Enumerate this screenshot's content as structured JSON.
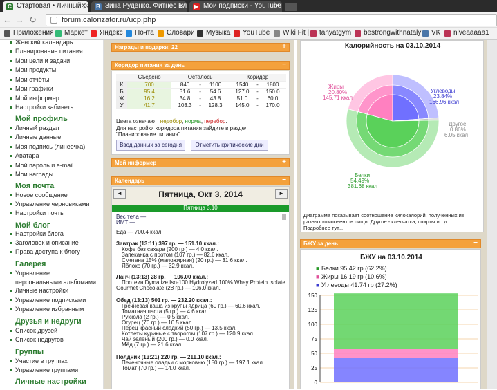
{
  "tabs": [
    {
      "label": "Стартовая • Личный разд"
    },
    {
      "label": "Зина Руденко. Фитнес Бл"
    },
    {
      "label": "Мои подписки - YouTube"
    }
  ],
  "url": "forum.calorizator.ru/ucp.php",
  "bookmarks": [
    "Приложения",
    "Маркет",
    "Яндекс",
    "Почта",
    "Словари",
    "Музыка",
    "YouTube",
    "Wiki Fit |",
    "tanyatgym",
    "bestrongwithnataly",
    "VK",
    "niveaaaaa1"
  ],
  "sidebar": {
    "links1": [
      "Женский календарь",
      "Планирование питания",
      "Мои цели и задачи",
      "Мои продукты",
      "Мои отчёты",
      "Мои графики",
      "Мой информер",
      "Настройки кабинета"
    ],
    "h_profile": "Мой профиль",
    "links2": [
      "Личный раздел",
      "Личные данные",
      "Моя подпись (линеечка)",
      "Аватара",
      "Мой пароль и e-mail",
      "Мои награды"
    ],
    "h_mail": "Моя почта",
    "links3": [
      "Новое сообщение",
      "Управление черновиками",
      "Настройки почты"
    ],
    "h_blog": "Мой блог",
    "links4": [
      "Настройки блога",
      "Заголовок и описание",
      "Права доступа к блогу"
    ],
    "h_gallery": "Галерея",
    "links5": [
      "Управление персональными альбомами",
      "Личные настройки",
      "Управление подписками",
      "Управление избранным"
    ],
    "h_friends": "Друзья и недруги",
    "links6": [
      "Список друзей",
      "Список недругов"
    ],
    "h_groups": "Группы",
    "links7": [
      "Участие в группах",
      "Управление группами"
    ],
    "h_settings": "Личные настройки"
  },
  "mid": {
    "awards": "Награды и подарки: 22",
    "corridor_title": "Коридор питания за день",
    "col_eaten": "Съедено",
    "col_left": "Осталось",
    "col_corr": "Коридор",
    "rows": [
      {
        "k": "К",
        "eaten": "700",
        "l1": "840",
        "l2": "1100",
        "c1": "1540",
        "c2": "1800"
      },
      {
        "k": "Б",
        "eaten": "95.4",
        "l1": "31.6",
        "l2": "54.6",
        "c1": "127.0",
        "c2": "150.0"
      },
      {
        "k": "Ж",
        "eaten": "16.2",
        "l1": "34.8",
        "l2": "43.8",
        "c1": "51.0",
        "c2": "60.0"
      },
      {
        "k": "У",
        "eaten": "41.7",
        "l1": "103.3",
        "l2": "128.3",
        "c1": "145.0",
        "c2": "170.0"
      }
    ],
    "colors_note": "Цвета означают:",
    "c_under": "недобор",
    "c_norm": "норма",
    "c_over": "перебор",
    "setup_note1": "Для настройки коридора питания зайдите в раздел",
    "setup_note2": "\"Планирование питания\".",
    "btn_enter": "Ввод данных за сегодня",
    "btn_crit": "Отметить критические дни",
    "informer": "Мой информер",
    "calendar": "Календарь",
    "date": "Пятница, Окт 3, 2014",
    "week": "Пятница 3.10",
    "weight": "Вес тела —",
    "bmi": "ИМТ —",
    "food_total": "Еда — 700.4 ккал.",
    "meals": [
      {
        "title": "Завтрак (13:11) 397 гр. — 151.10 ккал.:",
        "items": [
          "Кофе без сахара (200 гр.) — 4.0 ккал.",
          "Запеканка с протом (107 гр.) — 82.6 ккал.",
          "Сметана 15% (маложирная) (20 гр.) — 31.6 ккал.",
          "Яблоко (70 гр.) — 32.9 ккал."
        ]
      },
      {
        "title": "Ланч (13:13) 28 гр. — 106.00 ккал.:",
        "items": [
          "Протеин Dymatize Iso-100 Hydrolyzed 100% Whey Protein Isolate",
          "Gourmet Chocolate (28 гр.) — 106.0 ккал."
        ]
      },
      {
        "title": "Обед (13:13) 501 гр. — 232.20 ккал.:",
        "items": [
          "Гречневая каша из крупы ядрица (60 гр.) — 60.6 ккал.",
          "Томатная паста (5 гр.) — 4.6 ккал.",
          "Руккола (2 гр.) — 0.5 ккал.",
          "Огурец (70 гр.) — 10.5 ккал.",
          "Перец красный сладкий (50 гр.) — 13.5 ккал.",
          "Котлеты куриные с творогом (107 гр.) — 120.9 ккал.",
          "Чай зелёный (200 гр.) — 0.0 ккал.",
          "Мёд (7 гр.) — 21.6 ккал."
        ]
      },
      {
        "title": "Полдник (13:21) 220 гр. — 211.10 ккал.:",
        "items": [
          "Печеночные оладьи с морковью (150 гр.) — 197.1 ккал.",
          "Томат (70 гр.) — 14.0 ккал."
        ]
      }
    ]
  },
  "right": {
    "pie_title": "Калорийность на 03.10.2014",
    "fat": {
      "name": "Жиры",
      "pct": "20.80%",
      "kcal": "145.71 ккал"
    },
    "carb": {
      "name": "Углеводы",
      "pct": "23.84%",
      "kcal": "166.96 ккал"
    },
    "other": {
      "name": "Другое",
      "pct": "0.86%",
      "kcal": "6.05 ккал"
    },
    "prot": {
      "name": "Белки",
      "pct": "54.49%",
      "kcal": "381.68 ккал"
    },
    "pie_note1": "Диаграмма показывает соотношение килокалорий, полученных из",
    "pie_note2": "разных компонентов пищи. Другое - клетчатка, спирты и т.д.",
    "pie_note3": "Подробнее тут...",
    "bju_bar": "БЖУ за день",
    "bju_title": "БЖУ на 03.10.2014",
    "leg_prot": "Белки 95.42 гр (62.2%)",
    "leg_fat": "Жиры 16.19 гр (10.6%)",
    "leg_carb": "Углеводы 41.74 гр (27.2%)",
    "yticks": [
      "150",
      "125",
      "100",
      "75",
      "50",
      "25",
      "0"
    ]
  },
  "colors": {
    "protein": "#5ad15a",
    "fat": "#ff80c0",
    "carb": "#7070ff",
    "other": "#bbbbbb",
    "orange": "#f4a13c",
    "green": "#2e7d32"
  },
  "chart_data": [
    {
      "type": "pie",
      "title": "Калорийность на 03.10.2014",
      "labels": [
        "Белки",
        "Жиры",
        "Углеводы",
        "Другое"
      ],
      "values": [
        54.49,
        20.8,
        23.84,
        0.86
      ],
      "kcal": [
        381.68,
        145.71,
        166.96,
        6.05
      ]
    },
    {
      "type": "bar",
      "title": "БЖУ на 03.10.2014",
      "categories": [
        ""
      ],
      "series": [
        {
          "name": "Белки",
          "values": [
            95.42
          ]
        },
        {
          "name": "Жиры",
          "values": [
            16.19
          ]
        },
        {
          "name": "Углеводы",
          "values": [
            41.74
          ]
        }
      ],
      "ylim": [
        0,
        150
      ]
    }
  ]
}
